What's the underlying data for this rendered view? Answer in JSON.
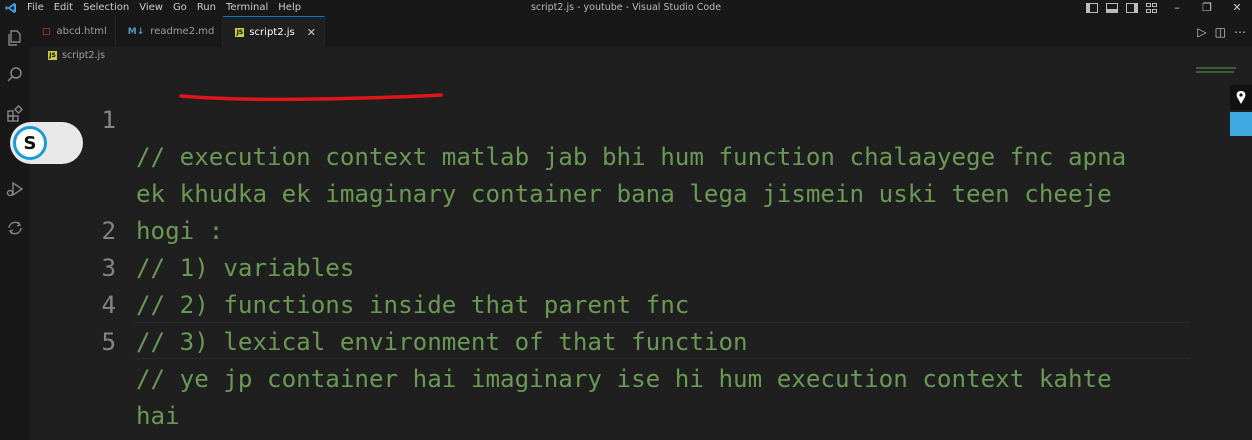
{
  "titlebar": {
    "menu": [
      "File",
      "Edit",
      "Selection",
      "View",
      "Go",
      "Run",
      "Terminal",
      "Help"
    ],
    "window_title": "script2.js - youtube - Visual Studio Code"
  },
  "tabs": [
    {
      "label": "abcd.html",
      "icon": "html-file-icon",
      "active": false
    },
    {
      "label": "readme2.md",
      "icon": "markdown-file-icon",
      "active": false
    },
    {
      "label": "script2.js",
      "icon": "js-file-icon",
      "active": true
    }
  ],
  "breadcrumb": {
    "file": "script2.js"
  },
  "overlay": {
    "badge_letter": "S"
  },
  "editor": {
    "lines": [
      {
        "num": "1",
        "text": "// execution context matlab jab bhi hum function chalaayege fnc apna"
      },
      {
        "num": "",
        "text": "ek khudka ek imaginary container bana lega jismein uski teen cheeje"
      },
      {
        "num": "",
        "text": "hogi :"
      },
      {
        "num": "2",
        "text": "// 1) variables"
      },
      {
        "num": "3",
        "text": "// 2) functions inside that parent fnc"
      },
      {
        "num": "4",
        "text": "// 3) lexical environment of that function"
      },
      {
        "num": "5",
        "text": "// ye jp container hai imaginary ise hi hum execution context kahte"
      },
      {
        "num": "",
        "text": "hai"
      }
    ]
  },
  "colors": {
    "comment": "#6a9955",
    "line_number": "#858585",
    "editor_bg": "#1f1f1f",
    "annotation": "#e0161b"
  }
}
